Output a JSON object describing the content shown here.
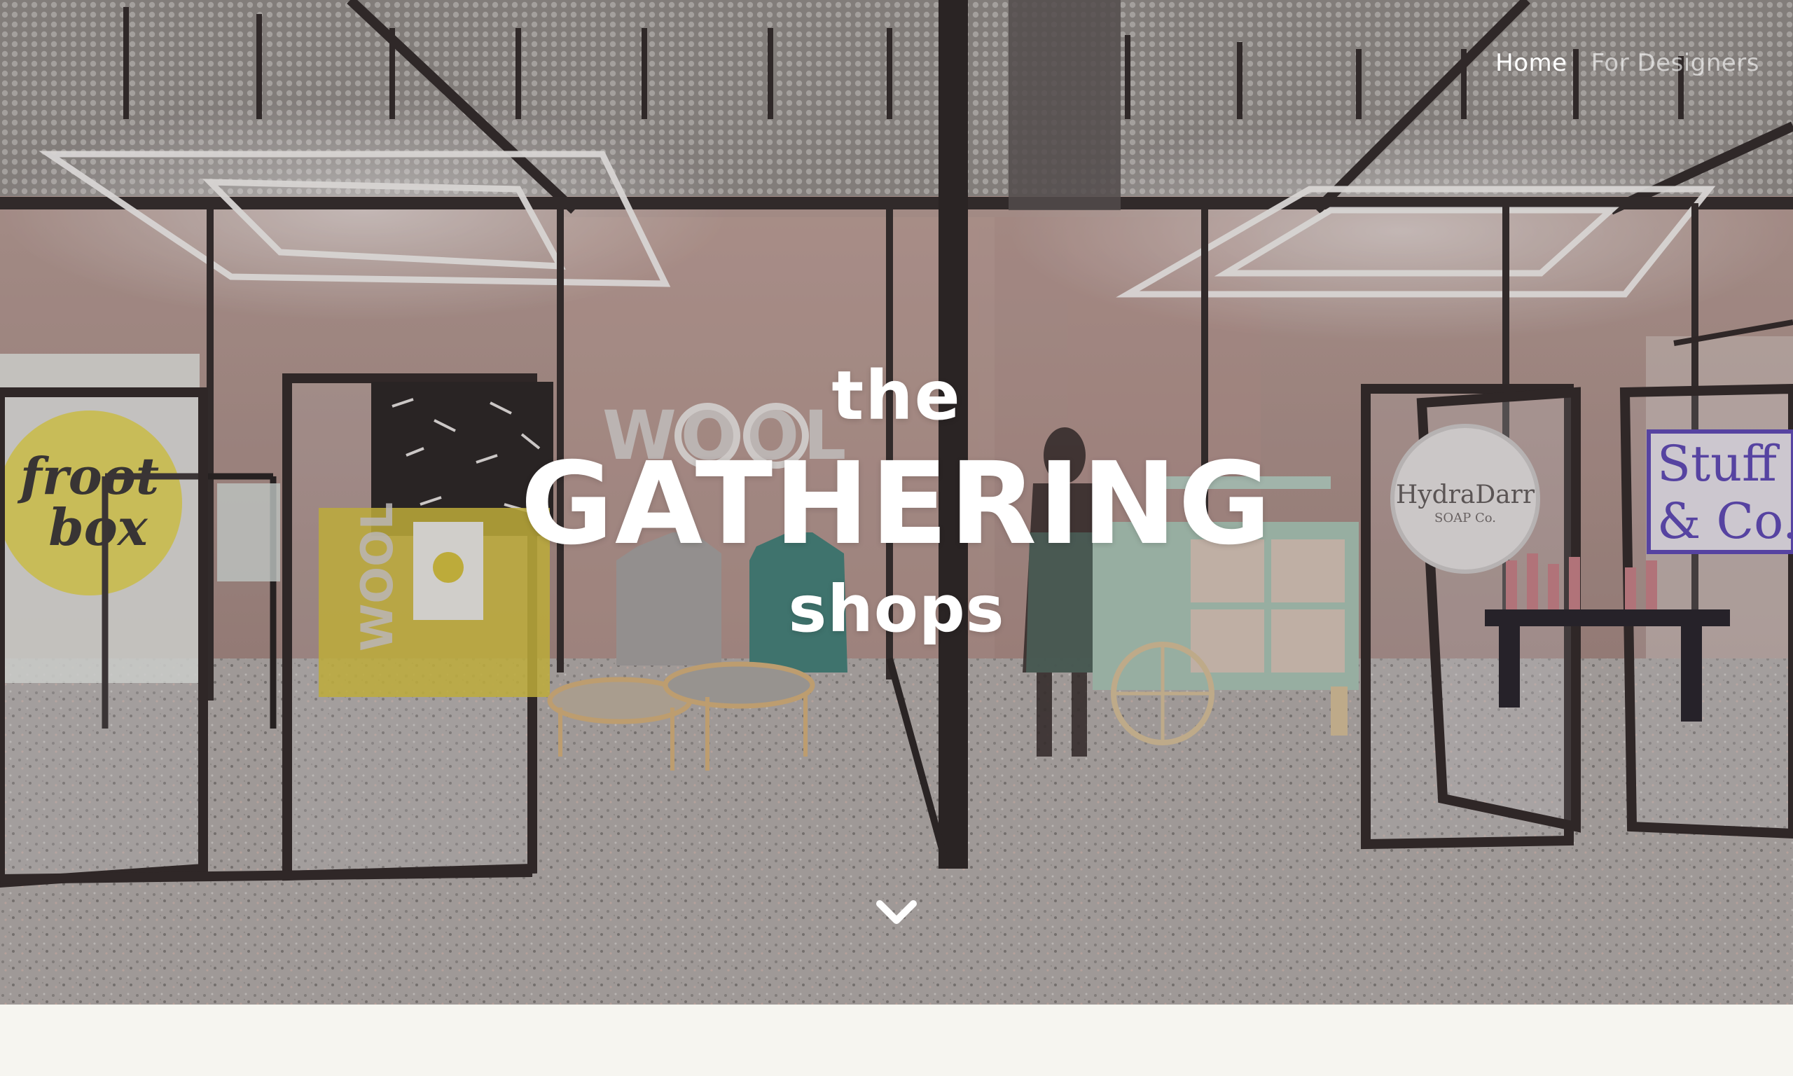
{
  "nav": {
    "home_label": "Home",
    "designers_label": "For Designers"
  },
  "hero": {
    "line1": "the",
    "line2": "GATHERING",
    "line3": "shops"
  },
  "scene_signs": {
    "froot_1": "froot",
    "froot_2": "box",
    "wool": "WOOL",
    "hydra": "HydraDarr",
    "hydra_sub": "SOAP Co.",
    "stuff_1": "Stuff",
    "stuff_2": "& Co."
  },
  "icons": {
    "scroll": "chevron-down-icon"
  },
  "colors": {
    "text": "#ffffff",
    "below_bg": "#f6f5f0",
    "froot_yellow": "#e4d64a",
    "stuff_purple": "#5a45b8"
  }
}
